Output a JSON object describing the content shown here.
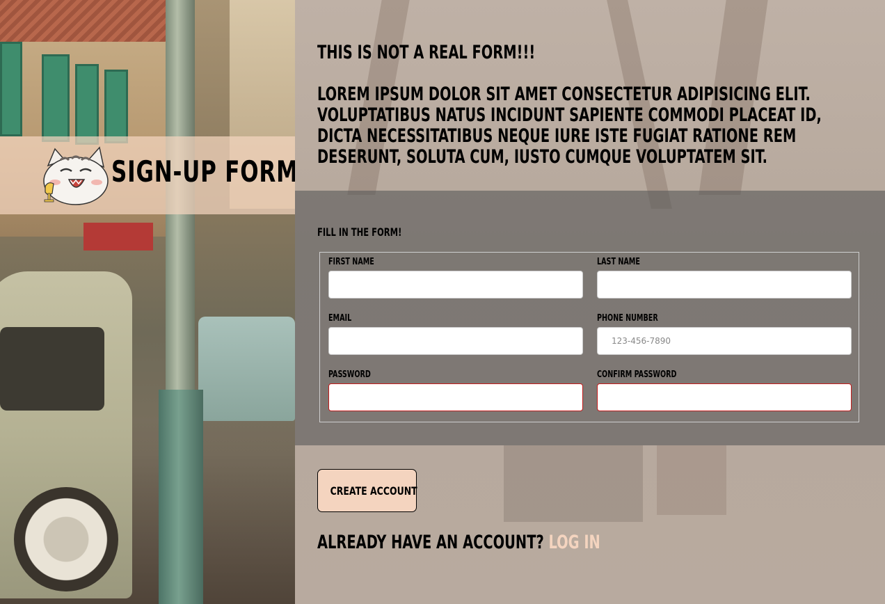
{
  "brand": {
    "title": "Sign-up Form"
  },
  "intro": {
    "heading": "This is not a real form!!!",
    "body": "Lorem ipsum dolor sit amet consectetur adipisicing elit. Voluptatibus natus incidunt sapiente commodi placeat id, dicta necessitatibus neque iure iste fugiat ratione rem deserunt, soluta cum, iusto cumque voluptatem sit."
  },
  "form": {
    "title": "Fill in the form!",
    "fields": {
      "first_name": {
        "label": "First name",
        "value": "",
        "placeholder": ""
      },
      "last_name": {
        "label": "Last name",
        "value": "",
        "placeholder": ""
      },
      "email": {
        "label": "Email",
        "value": "",
        "placeholder": ""
      },
      "phone": {
        "label": "Phone number",
        "value": "",
        "placeholder": "123-456-7890"
      },
      "password": {
        "label": "Password",
        "value": "",
        "placeholder": ""
      },
      "confirm_password": {
        "label": "Confirm password",
        "value": "",
        "placeholder": ""
      }
    }
  },
  "actions": {
    "create_label": "Create account",
    "login_prompt": "Already have an account?",
    "login_link": "Log in"
  },
  "colors": {
    "accent": "#f4d4bf",
    "invalid_border": "#c41b1b",
    "form_band": "#5a5a5a"
  }
}
